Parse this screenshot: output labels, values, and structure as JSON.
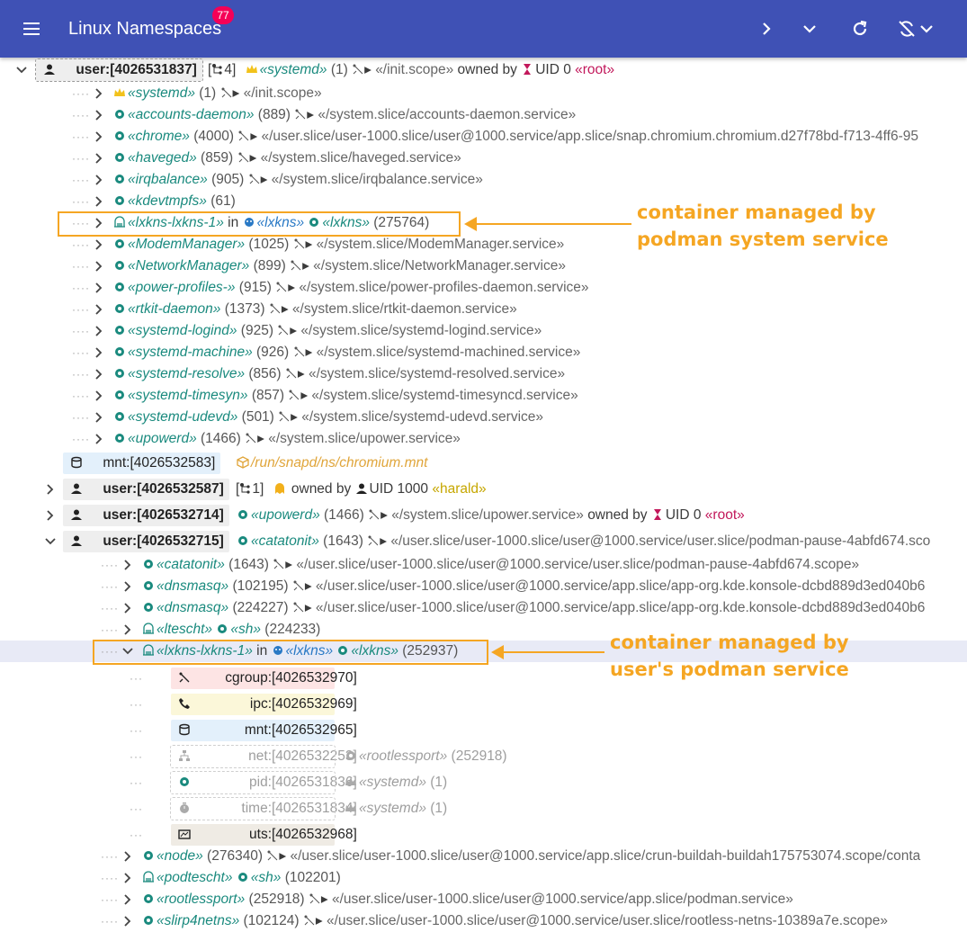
{
  "app": {
    "title": "Linux Namespaces",
    "badge": "77"
  },
  "colors": {
    "appbar": "#3f51b5",
    "badge": "#f50057",
    "process": "#1a8a7e",
    "root": "#c2185b",
    "annotation": "#f5a623"
  },
  "root_user": {
    "label": "user:[4026531837]",
    "children_count": "4",
    "process": "«systemd»",
    "pid": "(1)",
    "path": "«/init.scope»",
    "owned_by": "owned by",
    "uid": "UID 0",
    "owner": "«root»"
  },
  "root_children": [
    {
      "name": "«systemd»",
      "pid": "(1)",
      "path": "«/init.scope»",
      "icon": "crown-icon"
    },
    {
      "name": "«accounts-daemon»",
      "pid": "(889)",
      "path": "«/system.slice/accounts-daemon.service»",
      "icon": "gear-icon"
    },
    {
      "name": "«chrome»",
      "pid": "(4000)",
      "path": "«/user.slice/user-1000.slice/user@1000.service/app.slice/snap.chromium.chromium.d27f78bd-f713-4ff6-95",
      "icon": "gear-icon"
    },
    {
      "name": "«haveged»",
      "pid": "(859)",
      "path": "«/system.slice/haveged.service»",
      "icon": "gear-icon"
    },
    {
      "name": "«irqbalance»",
      "pid": "(905)",
      "path": "«/system.slice/irqbalance.service»",
      "icon": "gear-icon"
    },
    {
      "name": "«kdevtmpfs»",
      "pid": "(61)",
      "path": "",
      "icon": "gear-icon"
    },
    {
      "name": "«lxkns-lxkns-1»",
      "in": "in",
      "pod": "«lxkns»",
      "proc": "«lxkns»",
      "pid": "(275764)",
      "icon": "container-icon"
    },
    {
      "name": "«ModemManager»",
      "pid": "(1025)",
      "path": "«/system.slice/ModemManager.service»",
      "icon": "gear-icon"
    },
    {
      "name": "«NetworkManager»",
      "pid": "(899)",
      "path": "«/system.slice/NetworkManager.service»",
      "icon": "gear-icon"
    },
    {
      "name": "«power-profiles-»",
      "pid": "(915)",
      "path": "«/system.slice/power-profiles-daemon.service»",
      "icon": "gear-icon"
    },
    {
      "name": "«rtkit-daemon»",
      "pid": "(1373)",
      "path": "«/system.slice/rtkit-daemon.service»",
      "icon": "gear-icon"
    },
    {
      "name": "«systemd-logind»",
      "pid": "(925)",
      "path": "«/system.slice/systemd-logind.service»",
      "icon": "gear-icon"
    },
    {
      "name": "«systemd-machine»",
      "pid": "(926)",
      "path": "«/system.slice/systemd-machined.service»",
      "icon": "gear-icon"
    },
    {
      "name": "«systemd-resolve»",
      "pid": "(856)",
      "path": "«/system.slice/systemd-resolved.service»",
      "icon": "gear-icon"
    },
    {
      "name": "«systemd-timesyn»",
      "pid": "(857)",
      "path": "«/system.slice/systemd-timesyncd.service»",
      "icon": "gear-icon"
    },
    {
      "name": "«systemd-udevd»",
      "pid": "(501)",
      "path": "«/system.slice/systemd-udevd.service»",
      "icon": "gear-icon"
    },
    {
      "name": "«upowerd»",
      "pid": "(1466)",
      "path": "«/system.slice/upower.service»",
      "icon": "gear-icon"
    }
  ],
  "mnt_row": {
    "label": "mnt:[4026532583]",
    "path": "/run/snapd/ns/chromium.mnt"
  },
  "user_4026532587": {
    "label": "user:[4026532587]",
    "count": "1",
    "owned_by": "owned by",
    "uid": "UID 1000",
    "owner": "«harald»"
  },
  "user_4026532714": {
    "label": "user:[4026532714]",
    "process": "«upowerd»",
    "pid": "(1466)",
    "path": "«/system.slice/upower.service»",
    "owned_by": "owned by",
    "uid": "UID 0",
    "owner": "«root»"
  },
  "user_4026532715": {
    "label": "user:[4026532715]",
    "process": "«catatonit»",
    "pid": "(1643)",
    "path": "«/user.slice/user-1000.slice/user@1000.service/user.slice/podman-pause-4abfd674.sco"
  },
  "user_children": [
    {
      "name": "«catatonit»",
      "pid": "(1643)",
      "path": "«/user.slice/user-1000.slice/user@1000.service/user.slice/podman-pause-4abfd674.scope»",
      "icon": "gear-icon"
    },
    {
      "name": "«dnsmasq»",
      "pid": "(102195)",
      "path": "«/user.slice/user-1000.slice/user@1000.service/app.slice/app-org.kde.konsole-dcbd889d3ed040b6",
      "icon": "gear-icon"
    },
    {
      "name": "«dnsmasq»",
      "pid": "(224227)",
      "path": "«/user.slice/user-1000.slice/user@1000.service/app.slice/app-org.kde.konsole-dcbd889d3ed040b6",
      "icon": "gear-icon"
    },
    {
      "name": "«ltescht»",
      "proc": "«sh»",
      "pid": "(224233)",
      "icon": "container-icon"
    },
    {
      "name": "«lxkns-lxkns-1»",
      "in": "in",
      "pod": "«lxkns»",
      "proc": "«lxkns»",
      "pid": "(252937)",
      "icon": "container-icon"
    }
  ],
  "container_namespaces": [
    {
      "label": "cgroup:",
      "id": "[4026532970]",
      "kind": "cgroup",
      "icon": "cgroup-icon"
    },
    {
      "label": "ipc:",
      "id": "[4026532969]",
      "kind": "ipc",
      "icon": "phone-icon"
    },
    {
      "label": "mnt:",
      "id": "[4026532965]",
      "kind": "mnt",
      "icon": "database-icon"
    },
    {
      "label": "net:",
      "id": "[4026532253]",
      "kind": "shared",
      "icon": "network-icon",
      "proc": "«rootlessport»",
      "pid": "(252918)",
      "proc_icon": "gear-icon"
    },
    {
      "label": "pid:",
      "id": "[4026531836]",
      "kind": "shared",
      "icon": "gear-icon",
      "proc": "«systemd»",
      "pid": "(1)",
      "proc_icon": "crown-icon"
    },
    {
      "label": "time:",
      "id": "[4026531834]",
      "kind": "shared",
      "icon": "timer-icon",
      "proc": "«systemd»",
      "pid": "(1)",
      "proc_icon": "crown-icon"
    },
    {
      "label": "uts:",
      "id": "[4026532968]",
      "kind": "uts",
      "icon": "uts-icon"
    }
  ],
  "user_children_tail": [
    {
      "name": "«node»",
      "pid": "(276340)",
      "path": "«/user.slice/user-1000.slice/user@1000.service/app.slice/crun-buildah-buildah175753074.scope/conta",
      "icon": "gear-icon"
    },
    {
      "name": "«podtescht»",
      "proc": "«sh»",
      "pid": "(102201)",
      "icon": "container-icon"
    },
    {
      "name": "«rootlessport»",
      "pid": "(252918)",
      "path": "«/user.slice/user-1000.slice/user@1000.service/app.slice/podman.service»",
      "icon": "gear-icon"
    },
    {
      "name": "«slirp4netns»",
      "pid": "(102124)",
      "path": "«/user.slice/user-1000.slice/user@1000.service/user.slice/rootless-netns-10389a7e.scope»",
      "icon": "gear-icon"
    }
  ],
  "annotations": {
    "a1_line1": "container managed by",
    "a1_line2": "podman system service",
    "a2_line1": "container managed by",
    "a2_line2": "user's podman service"
  }
}
